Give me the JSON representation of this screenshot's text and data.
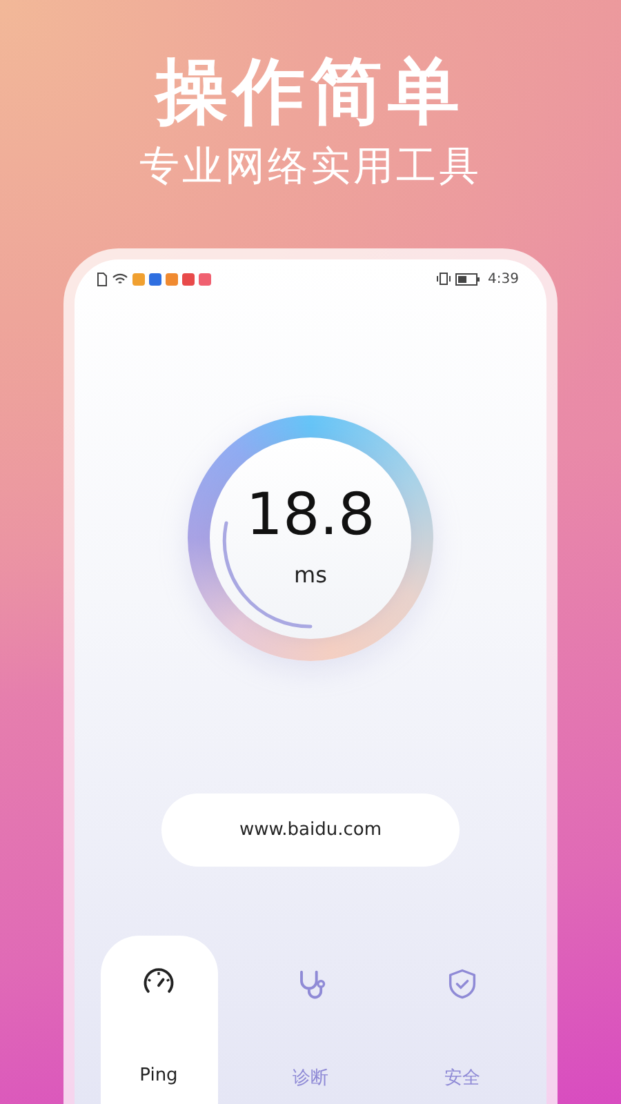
{
  "headline": "操作简单",
  "subtitle": "专业网络实用工具",
  "status_bar": {
    "time": "4:39",
    "notifications": [
      {
        "color": "#f0a030"
      },
      {
        "color": "#2f6fe0"
      },
      {
        "color": "#f08a30"
      },
      {
        "color": "#e84a4a"
      },
      {
        "color": "#f06070"
      }
    ]
  },
  "gauge": {
    "value": "18.8",
    "unit": "ms"
  },
  "host_field": {
    "value": "www.baidu.com"
  },
  "tabs": [
    {
      "label": "Ping",
      "kind": "speedometer",
      "selected": true
    },
    {
      "label": "诊断",
      "kind": "stethoscope",
      "selected": false
    },
    {
      "label": "安全",
      "kind": "shield",
      "selected": false
    }
  ]
}
